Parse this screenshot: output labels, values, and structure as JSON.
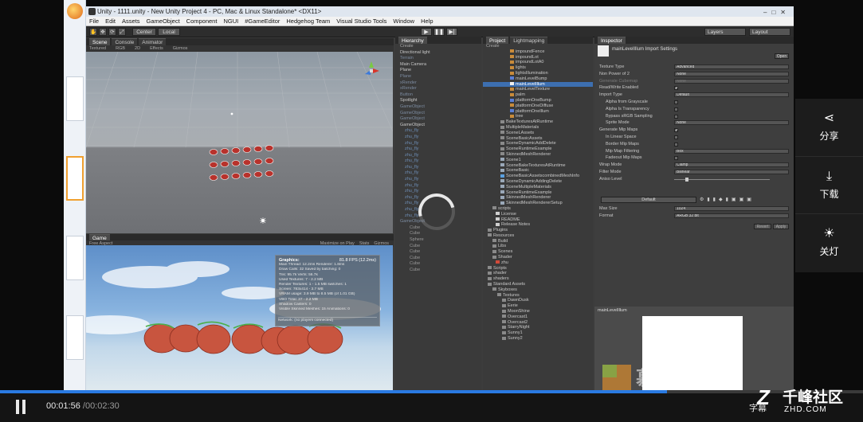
{
  "window": {
    "title": "Unity - 1111.unity - New Unity Project 4 - PC, Mac & Linux Standalone* <DX11>"
  },
  "menubar": [
    "File",
    "Edit",
    "Assets",
    "GameObject",
    "Component",
    "NGUI",
    "#GameEditor",
    "Hedgehog Team",
    "Visual Studio Tools",
    "Window",
    "Help"
  ],
  "toolbar": {
    "pivot": "Center",
    "space": "Local",
    "layers": "Layers",
    "layout": "Layout"
  },
  "scene_panel": {
    "tabs": [
      "Scene",
      "Console",
      "Animator"
    ],
    "sub": [
      "Textured",
      "RGB",
      "2D",
      "Effects",
      "Gizmos"
    ]
  },
  "game_panel": {
    "tab": "Game",
    "aspect": "Free Aspect",
    "options": [
      "Maximize on Play",
      "Stats",
      "Gizmos"
    ]
  },
  "stats": {
    "header": "Graphics:",
    "fps": "81.8 FPS (12.2ms)",
    "rows": [
      "Main Thread: 12.2ms  Renderer: 1.8ms",
      "Draw Calls: 32    Saved by batching: 0",
      "Tris: 95.7k   Verts: 56.7k",
      "Used Textures: 7 - 2.2 MB",
      "Render Textures: 1 - 1.5 MB  switches: 1",
      "Screen: 783x414 - 3.7 MB",
      "VRAM usage: 3.9 MB to 8.5 MB (of 1.01 GB)",
      "VBO Total: 37 - 2.2 MB",
      "Shadow Casters: 0",
      "Visible Skinned Meshes: 15   Animations: 0"
    ],
    "network": "Network: (no players connected)"
  },
  "hierarchy": {
    "tab": "Hierarchy",
    "create": "Create",
    "items": [
      {
        "label": "Directional light",
        "kind": "item"
      },
      {
        "label": "Terrain",
        "kind": "dim"
      },
      {
        "label": "Main Camera",
        "kind": "item"
      },
      {
        "label": "Plane",
        "kind": "item"
      },
      {
        "label": "Plane",
        "kind": "dim"
      },
      {
        "label": "xRender",
        "kind": "dim"
      },
      {
        "label": "xRender",
        "kind": "dim"
      },
      {
        "label": "Button",
        "kind": "dim"
      },
      {
        "label": "Spotlight",
        "kind": "item"
      },
      {
        "label": "GameObject",
        "kind": "dim"
      },
      {
        "label": "GameObject",
        "kind": "dim"
      },
      {
        "label": "GameObject",
        "kind": "dim"
      },
      {
        "label": "GameObject",
        "kind": "item"
      },
      {
        "label": "zhu_fly",
        "kind": "child"
      },
      {
        "label": "zhu_fly",
        "kind": "child"
      },
      {
        "label": "zhu_fly",
        "kind": "child"
      },
      {
        "label": "zhu_fly",
        "kind": "child"
      },
      {
        "label": "zhu_fly",
        "kind": "child"
      },
      {
        "label": "zhu_fly",
        "kind": "child"
      },
      {
        "label": "zhu_fly",
        "kind": "child"
      },
      {
        "label": "zhu_fly",
        "kind": "child"
      },
      {
        "label": "zhu_fly",
        "kind": "child"
      },
      {
        "label": "zhu_fly",
        "kind": "child"
      },
      {
        "label": "zhu_fly",
        "kind": "child"
      },
      {
        "label": "zhu_fly",
        "kind": "child"
      },
      {
        "label": "zhu_fly",
        "kind": "child"
      },
      {
        "label": "zhu_fly",
        "kind": "child"
      },
      {
        "label": "zhu_fly",
        "kind": "child"
      },
      {
        "label": "GameObject",
        "kind": "dim"
      },
      {
        "label": "Cube",
        "kind": "sub"
      },
      {
        "label": "Cube",
        "kind": "sub"
      },
      {
        "label": "Sphere",
        "kind": "sub"
      },
      {
        "label": "Cube",
        "kind": "sub"
      },
      {
        "label": "Cube",
        "kind": "sub"
      },
      {
        "label": "Cube",
        "kind": "sub"
      },
      {
        "label": "Cube",
        "kind": "sub"
      },
      {
        "label": "Cube",
        "kind": "sub"
      }
    ]
  },
  "project": {
    "tabs": [
      "Project",
      "Lightmapping"
    ],
    "create": "Create",
    "items": [
      {
        "label": "impoundFence",
        "icon": "texture",
        "indent": 34
      },
      {
        "label": "impoundLot",
        "icon": "texture",
        "indent": 34
      },
      {
        "label": "impoundLotA0",
        "icon": "texture",
        "indent": 34
      },
      {
        "label": "lights",
        "icon": "texture",
        "indent": 34
      },
      {
        "label": "lightsIllumination",
        "icon": "texture",
        "indent": 34
      },
      {
        "label": "mainLevelBump",
        "icon": "texture-blue",
        "indent": 34
      },
      {
        "label": "mainLevelIllum",
        "icon": "texture-white",
        "indent": 34,
        "selected": true
      },
      {
        "label": "mainLevelTexture",
        "icon": "texture",
        "indent": 34
      },
      {
        "label": "palm",
        "icon": "texture",
        "indent": 34
      },
      {
        "label": "platformOneBump",
        "icon": "texture-blue",
        "indent": 34
      },
      {
        "label": "platformOneDiffuse",
        "icon": "texture",
        "indent": 34
      },
      {
        "label": "platformOneIllum",
        "icon": "texture-blue",
        "indent": 34
      },
      {
        "label": "tree",
        "icon": "texture",
        "indent": 34
      },
      {
        "label": "BakeTexturesAtRuntime",
        "icon": "folder",
        "indent": 22
      },
      {
        "label": "MultipleMaterials",
        "icon": "folder",
        "indent": 22
      },
      {
        "label": "SceneLAssets",
        "icon": "folder",
        "indent": 22
      },
      {
        "label": "SceneBasicAssets",
        "icon": "folder",
        "indent": 22
      },
      {
        "label": "SceneDynamicAddDelete",
        "icon": "folder",
        "indent": 22
      },
      {
        "label": "SceneRuntimeExample",
        "icon": "folder",
        "indent": 22
      },
      {
        "label": "SkinnedMeshRenderer",
        "icon": "folder",
        "indent": 22
      },
      {
        "label": "Scene1",
        "icon": "scene",
        "indent": 22
      },
      {
        "label": "SceneBakeTexturesAtRuntime",
        "icon": "scene",
        "indent": 22
      },
      {
        "label": "SceneBasic",
        "icon": "scene",
        "indent": 22
      },
      {
        "label": "SceneBasicAssetscombinedMeshInfo",
        "icon": "scene-blue",
        "indent": 22
      },
      {
        "label": "SceneDynamicAddingDelete",
        "icon": "scene",
        "indent": 22
      },
      {
        "label": "SceneMultipleMaterials",
        "icon": "scene",
        "indent": 22
      },
      {
        "label": "SceneRuntimeExample",
        "icon": "scene",
        "indent": 22
      },
      {
        "label": "SkinnedMeshRenderer",
        "icon": "scene",
        "indent": 22
      },
      {
        "label": "SkinnedMeshRendererSetup",
        "icon": "scene",
        "indent": 22
      },
      {
        "label": "scripts",
        "icon": "folder",
        "indent": 12
      },
      {
        "label": "License",
        "icon": "doc",
        "indent": 16
      },
      {
        "label": "README",
        "icon": "doc",
        "indent": 16
      },
      {
        "label": "Release Notes",
        "icon": "doc",
        "indent": 16
      },
      {
        "label": "Plugins",
        "icon": "folder",
        "indent": 6
      },
      {
        "label": "Resources",
        "icon": "folder",
        "indent": 6
      },
      {
        "label": "Build",
        "icon": "folder",
        "indent": 12
      },
      {
        "label": "Libs",
        "icon": "folder",
        "indent": 12
      },
      {
        "label": "Scenes",
        "icon": "folder",
        "indent": 12
      },
      {
        "label": "Shader",
        "icon": "folder",
        "indent": 12
      },
      {
        "label": "zhu",
        "icon": "scene-red",
        "indent": 16
      },
      {
        "label": "Scripts",
        "icon": "folder",
        "indent": 6
      },
      {
        "label": "shader",
        "icon": "folder",
        "indent": 6
      },
      {
        "label": "shaders",
        "icon": "folder",
        "indent": 6
      },
      {
        "label": "Standard Assets",
        "icon": "folder",
        "indent": 6
      },
      {
        "label": "Skyboxes",
        "icon": "folder",
        "indent": 12
      },
      {
        "label": "Textures",
        "icon": "folder",
        "indent": 18
      },
      {
        "label": "DawnDusk",
        "icon": "folder",
        "indent": 24
      },
      {
        "label": "Eerie",
        "icon": "folder",
        "indent": 24
      },
      {
        "label": "MoonShine",
        "icon": "folder",
        "indent": 24
      },
      {
        "label": "Overcast1",
        "icon": "folder",
        "indent": 24
      },
      {
        "label": "Overcast2",
        "icon": "folder",
        "indent": 24
      },
      {
        "label": "StarryNight",
        "icon": "folder",
        "indent": 24
      },
      {
        "label": "Sunny1",
        "icon": "folder",
        "indent": 24
      },
      {
        "label": "Sunny2",
        "icon": "folder",
        "indent": 24
      }
    ]
  },
  "inspector": {
    "tab": "Inspector",
    "title": "mainLevelIllum Import Settings",
    "open": "Open",
    "rows": [
      {
        "label": "Texture Type",
        "value": "Advanced",
        "type": "select"
      },
      {
        "label": "Non Power of 2",
        "value": "None",
        "type": "select"
      },
      {
        "label": "Generate Cubemap",
        "value": "None",
        "type": "select-dim"
      },
      {
        "label": "Read/Write Enabled",
        "value": "",
        "type": "check-on"
      },
      {
        "label": "Import Type",
        "value": "Default",
        "type": "select"
      },
      {
        "label": "Alpha from Grayscale",
        "value": "",
        "type": "check",
        "indent": true
      },
      {
        "label": "Alpha Is Transparency",
        "value": "",
        "type": "check",
        "indent": true
      },
      {
        "label": "Bypass sRGB Sampling",
        "value": "",
        "type": "check",
        "indent": true
      },
      {
        "label": "Sprite Mode",
        "value": "None",
        "type": "select",
        "indent": true
      },
      {
        "label": "Generate Mip Maps",
        "value": "",
        "type": "check-on"
      },
      {
        "label": "In Linear Space",
        "value": "",
        "type": "check",
        "indent": true
      },
      {
        "label": "Border Mip Maps",
        "value": "",
        "type": "check",
        "indent": true
      },
      {
        "label": "Mip Map Filtering",
        "value": "Box",
        "type": "select",
        "indent": true
      },
      {
        "label": "Fadeout Mip Maps",
        "value": "",
        "type": "check",
        "indent": true
      },
      {
        "label": "Wrap Mode",
        "value": "Clamp",
        "type": "select"
      },
      {
        "label": "Filter Mode",
        "value": "Bilinear",
        "type": "select"
      },
      {
        "label": "Aniso Level",
        "value": "",
        "type": "slider"
      }
    ],
    "platform_default": "Default",
    "max_size_label": "Max Size",
    "max_size": "1024",
    "format_label": "Format",
    "format": "ARGB 32 bit",
    "revert": "Revert",
    "apply": "Apply",
    "preview_title": "mainLevelIllum"
  },
  "watermark": "慕课在线",
  "side_panel": {
    "share": "分享",
    "download": "下载",
    "lights_off": "关灯"
  },
  "player": {
    "current": "00:01:56",
    "total": "/00:02:30",
    "progress": 0.773,
    "subtitle": "字幕"
  },
  "brand": {
    "name": "千峰社区",
    "url": "ZHD.COM"
  },
  "colors": {
    "accent": "#2a7ae2",
    "selection": "#3d6fb0"
  }
}
